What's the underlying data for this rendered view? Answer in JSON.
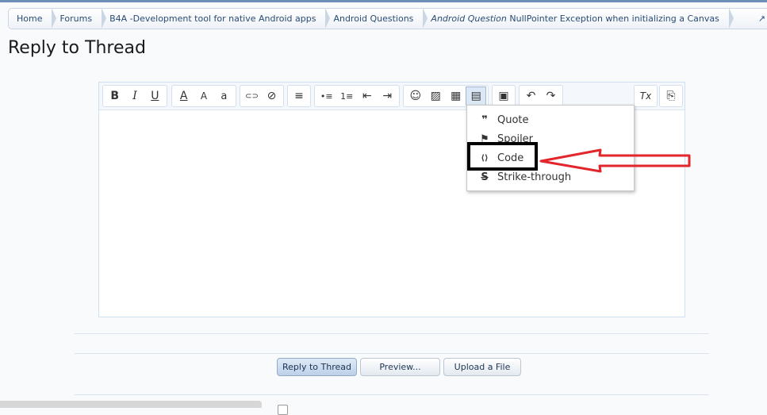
{
  "breadcrumb": {
    "items": [
      {
        "label": "Home"
      },
      {
        "label": "Forums"
      },
      {
        "label": "B4A -Development tool for native Android apps"
      },
      {
        "label": "Android Questions"
      }
    ],
    "thread_prefix": "Android Question",
    "thread_title": "NullPointer Exception when initializing a Canvas",
    "external_icon": "↗"
  },
  "page": {
    "title": "Reply to Thread"
  },
  "toolbar": {
    "bold": "B",
    "italic": "I",
    "underline": "U",
    "font_color": "A",
    "font_size": "A",
    "font_family": "a",
    "link": "⊂⊃",
    "unlink": "⊘",
    "align": "≡",
    "bullets": "•≡",
    "numbers": "1≡",
    "outdent": "⇤",
    "indent": "⇥",
    "smilies": "☺",
    "image": "▨",
    "media": "▦",
    "insert": "▤",
    "save": "▣",
    "undo": "↶",
    "redo": "↷",
    "remove_format": "Tx",
    "switch_mode": "⎘"
  },
  "insert_menu": {
    "items": [
      {
        "label": "Quote",
        "icon": "❞"
      },
      {
        "label": "Spoiler",
        "icon": "⚑"
      },
      {
        "label": "Code",
        "icon": "⟨⟩"
      },
      {
        "label": "Strike-through",
        "icon": "S"
      }
    ]
  },
  "actions": {
    "reply": "Reply to Thread",
    "preview": "Preview...",
    "upload": "Upload a File"
  },
  "colors": {
    "accent": "#2a4c74",
    "arrow": "#e2262b"
  }
}
